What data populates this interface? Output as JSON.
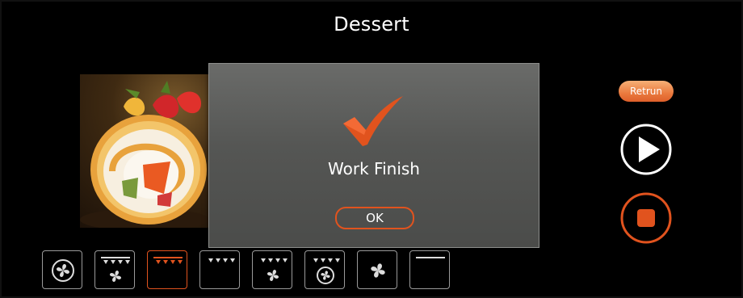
{
  "header": {
    "title": "Dessert"
  },
  "dialog": {
    "message": "Work Finish",
    "ok_label": "OK"
  },
  "controls": {
    "return_label": "Retrun"
  },
  "modes": [
    {
      "icon": "fan-circle-icon",
      "active": false
    },
    {
      "icon": "top-heat-fan-icon",
      "active": false
    },
    {
      "icon": "top-heat-icon",
      "active": true
    },
    {
      "icon": "top-heat-only-icon",
      "active": false
    },
    {
      "icon": "top-heat-fan-alt-icon",
      "active": false
    },
    {
      "icon": "top-heat-fan-circle-icon",
      "active": false
    },
    {
      "icon": "fan-icon",
      "active": false
    },
    {
      "icon": "bottom-heat-icon",
      "active": false
    }
  ],
  "colors": {
    "accent": "#e1531e",
    "dialog_bg": "#5a5b59",
    "background": "#000000"
  }
}
